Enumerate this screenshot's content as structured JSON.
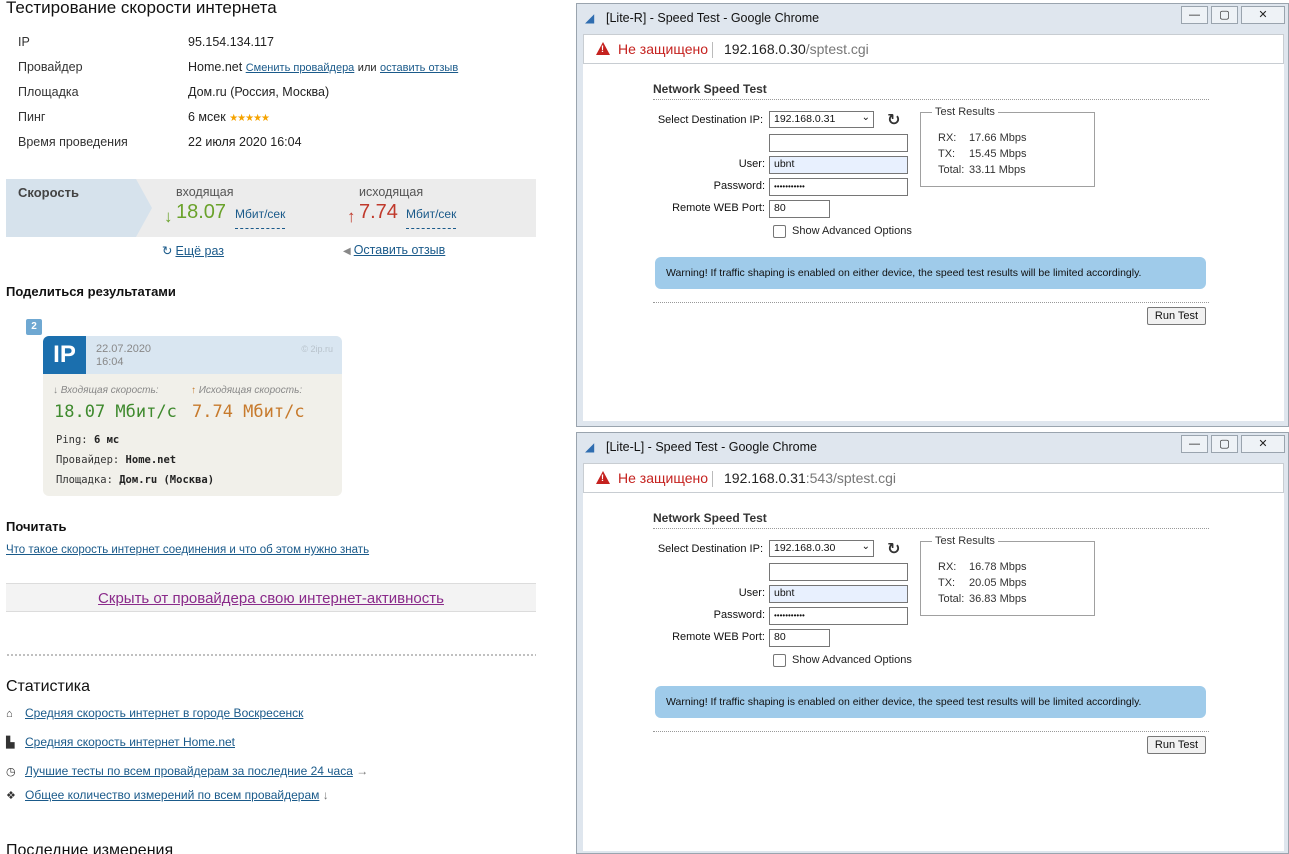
{
  "left": {
    "title": "Тестирование скорости интернета",
    "info": [
      {
        "label": "IP",
        "value": "95.154.134.117"
      },
      {
        "label": "Провайдер",
        "value": "Home.net",
        "link1": "Сменить провайдера",
        "mid": "или",
        "link2": "оставить отзыв"
      },
      {
        "label": "Площадка",
        "value": "Дом.ru (Россия, Москва)"
      },
      {
        "label": "Пинг",
        "value": "6 мсек",
        "stars": "★★★★★"
      },
      {
        "label": "Время проведения",
        "value": "22 июля 2020 16:04"
      }
    ],
    "speed": {
      "tab": "Скорость",
      "in_label": "входящая",
      "in_value": "18.07",
      "out_label": "исходящая",
      "out_value": "7.74",
      "unit": "Мбит/сек",
      "in_color": "#6aa22b",
      "out_color": "#c0392b"
    },
    "again": "Ещё раз",
    "review": "Оставить отзыв",
    "share_title": "Поделиться результатами",
    "card": {
      "badge": "2",
      "logo": "IP",
      "date": "22.07.2020",
      "time": "16:04",
      "watermark": "© 2ip.ru",
      "in_label": "Входящая скорость:",
      "out_label": "Исходящая скорость:",
      "in_value": "18.07 Мбит/с",
      "out_value": "7.74 Мбит/с",
      "ping_label": "Ping:",
      "ping_value": "6 мс",
      "provider_label": "Провайдер:",
      "provider_value": "Home.net",
      "site_label": "Площадка:",
      "site_value": "Дом.ru (Москва)"
    },
    "read_title": "Почитать",
    "read_link": "Что такое скорость интернет соединения и что об этом нужно знать",
    "hide_link": "Скрыть от провайдера свою интернет-активность",
    "stats_title": "Статистика",
    "stats": [
      {
        "icon": "home-icon",
        "text": "Средняя скорость интернет в городе Воскресенск",
        "tail": ""
      },
      {
        "icon": "chart-icon",
        "text": "Средняя скорость интернет Home.net",
        "tail": ""
      },
      {
        "icon": "clock-icon",
        "text": "Лучшие тесты по всем провайдерам за последние 24 часа",
        "tail": "→"
      },
      {
        "icon": "cubes-icon",
        "text": "Общее количество измерений по всем провайдерам",
        "tail": "↓"
      }
    ],
    "last_title": "Последние измерения"
  },
  "windows": [
    {
      "title": "[Lite-R] - Speed Test - Google Chrome",
      "not_secure": "Не защищено",
      "url_host": "192.168.0.30",
      "url_path": "/sptest.cgi",
      "heading": "Network Speed Test",
      "dest_label": "Select Destination IP:",
      "dest_value": "192.168.0.31",
      "user_label": "User:",
      "user_value": "ubnt",
      "pass_label": "Password:",
      "pass_value": "•••••••••••",
      "port_label": "Remote WEB Port:",
      "port_value": "80",
      "adv_label": "Show Advanced Options",
      "results_legend": "Test Results",
      "rx_label": "RX:",
      "rx_value": "17.66 Mbps",
      "tx_label": "TX:",
      "tx_value": "15.45 Mbps",
      "total_label": "Total:",
      "total_value": "33.11 Mbps",
      "warning": "Warning! If traffic shaping is enabled on either device, the speed test results will be limited accordingly.",
      "run": "Run Test"
    },
    {
      "title": "[Lite-L] - Speed Test - Google Chrome",
      "not_secure": "Не защищено",
      "url_host": "192.168.0.31",
      "url_path": ":543/sptest.cgi",
      "heading": "Network Speed Test",
      "dest_label": "Select Destination IP:",
      "dest_value": "192.168.0.30",
      "user_label": "User:",
      "user_value": "ubnt",
      "pass_label": "Password:",
      "pass_value": "•••••••••••",
      "port_label": "Remote WEB Port:",
      "port_value": "80",
      "adv_label": "Show Advanced Options",
      "results_legend": "Test Results",
      "rx_label": "RX:",
      "rx_value": "16.78 Mbps",
      "tx_label": "TX:",
      "tx_value": "20.05 Mbps",
      "total_label": "Total:",
      "total_value": "36.83 Mbps",
      "warning": "Warning! If traffic shaping is enabled on either device, the speed test results will be limited accordingly.",
      "run": "Run Test"
    }
  ]
}
